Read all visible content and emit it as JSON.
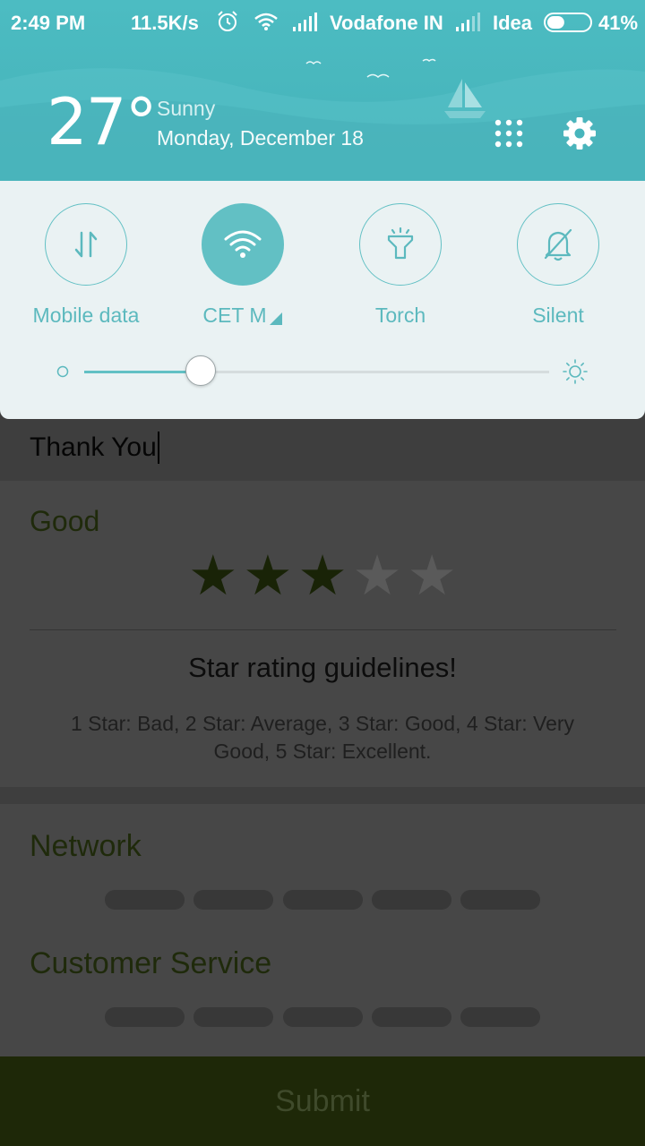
{
  "status_bar": {
    "time": "2:49 PM",
    "net_speed": "11.5K/s",
    "carrier1": "Vodafone IN",
    "carrier2": "Idea",
    "battery_pct": "41%",
    "battery_level": 0.41
  },
  "weather": {
    "temperature": "27°",
    "condition": "Sunny",
    "date": "Monday, December 18"
  },
  "quick_settings": {
    "tiles": [
      {
        "label": "Mobile data",
        "icon": "mobile-data-icon",
        "active": false
      },
      {
        "label": "CET M",
        "icon": "wifi-icon",
        "active": true
      },
      {
        "label": "Torch",
        "icon": "torch-icon",
        "active": false
      },
      {
        "label": "Silent",
        "icon": "silent-bell-icon",
        "active": false
      }
    ],
    "brightness_level": 0.25
  },
  "app": {
    "feedback_text": "Thank You",
    "rating_label": "Good",
    "rating_value": 3,
    "rating_max": 5,
    "guidelines_title": "Star rating guidelines!",
    "guidelines_text": "1 Star: Bad, 2 Star: Average, 3 Star: Good, 4 Star: Very Good, 5 Star: Excellent.",
    "network_label": "Network",
    "customer_service_label": "Customer Service",
    "submit_label": "Submit"
  },
  "colors": {
    "accent": "#62c0c4",
    "header": "#4cbcc2",
    "panel": "#eaf2f3",
    "submit_bar": "#1e2808"
  }
}
